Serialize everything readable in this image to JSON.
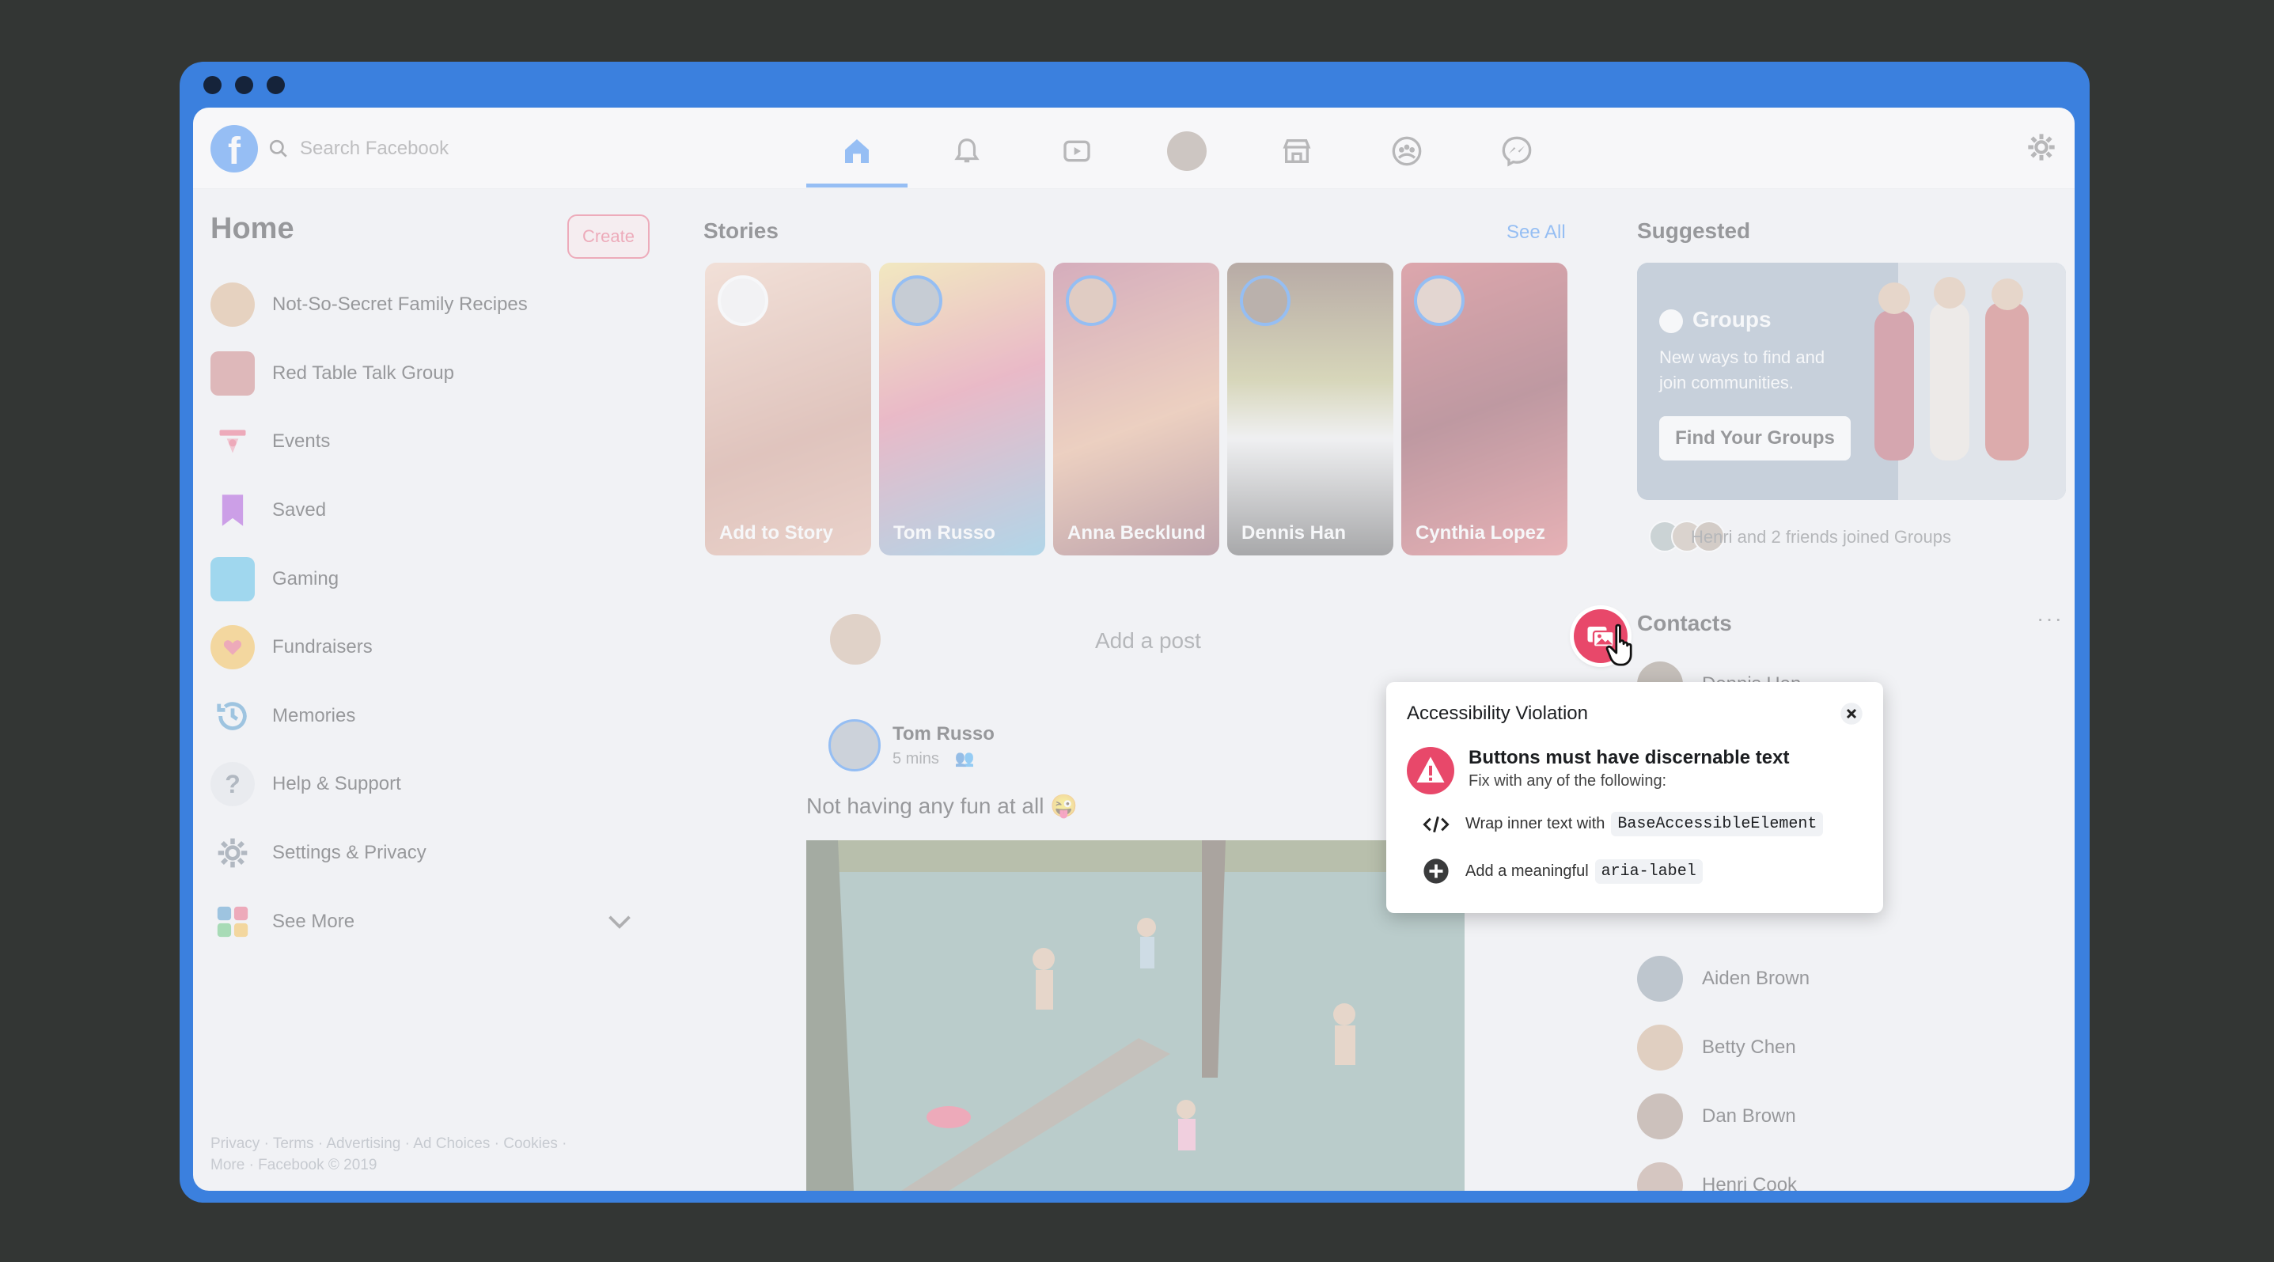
{
  "colors": {
    "background": "#333634",
    "window_frame": "#3b80de",
    "accent": "#1877f2",
    "violation": "#e8486a"
  },
  "topnav": {
    "search_placeholder": "Search Facebook",
    "icons": [
      "home-icon",
      "bell-icon",
      "video-icon",
      "profile-avatar",
      "marketplace-icon",
      "groups-icon",
      "messenger-icon",
      "gear-icon"
    ]
  },
  "sidebar": {
    "title": "Home",
    "create_label": "Create",
    "items": [
      {
        "label": "Not-So-Secret Family Recipes",
        "icon": "group-photo"
      },
      {
        "label": "Red Table Talk Group",
        "icon": "group-photo"
      },
      {
        "label": "Events",
        "icon": "calendar-icon"
      },
      {
        "label": "Saved",
        "icon": "bookmark-icon"
      },
      {
        "label": "Gaming",
        "icon": "gaming-icon"
      },
      {
        "label": "Fundraisers",
        "icon": "heart-icon"
      },
      {
        "label": "Memories",
        "icon": "clock-icon"
      },
      {
        "label": "Help & Support",
        "icon": "question-icon"
      },
      {
        "label": "Settings & Privacy",
        "icon": "gear-icon"
      },
      {
        "label": "See More",
        "icon": "grid-icon"
      }
    ],
    "footer_line1": "Privacy · Terms · Advertising · Ad Choices · Cookies ·",
    "footer_line2": "More · Facebook © 2019"
  },
  "stories": {
    "title": "Stories",
    "see_all": "See All",
    "items": [
      {
        "label": "Add to Story"
      },
      {
        "label": "Tom Russo"
      },
      {
        "label": "Anna Becklund"
      },
      {
        "label": "Dennis Han"
      },
      {
        "label": "Cynthia Lopez"
      }
    ]
  },
  "composer": {
    "placeholder": "Add a post"
  },
  "post": {
    "author": "Tom Russo",
    "time": "5 mins",
    "text": "Not having any fun at all 😜"
  },
  "suggested": {
    "title": "Suggested",
    "card_title": "Groups",
    "card_subtitle": "New ways to find and join communities.",
    "button": "Find Your Groups",
    "joined": "Henri and 2 friends joined Groups"
  },
  "contacts": {
    "title": "Contacts",
    "more": "···",
    "items": [
      {
        "name": "Dennis Han"
      },
      {
        "name": "Aiden Brown"
      },
      {
        "name": "Betty Chen"
      },
      {
        "name": "Dan Brown"
      },
      {
        "name": "Henri Cook"
      }
    ]
  },
  "popup": {
    "title": "Accessibility Violation",
    "heading": "Buttons must have discernable text",
    "subtext": "Fix with any of the following:",
    "fix1_text": "Wrap inner text with",
    "fix1_code": "BaseAccessibleElement",
    "fix2_text": "Add a meaningful",
    "fix2_code": "aria-label"
  }
}
